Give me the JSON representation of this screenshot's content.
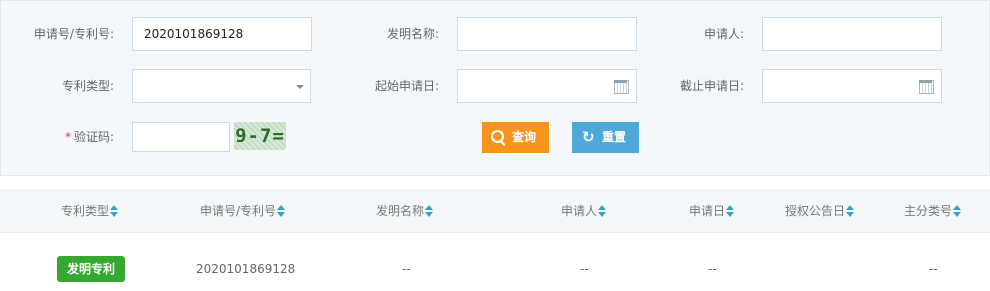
{
  "search": {
    "labels": {
      "app_no": "申请号/专利号:",
      "invention_name": "发明名称:",
      "applicant": "申请人:",
      "patent_type": "专利类型:",
      "start_date": "起始申请日:",
      "end_date": "截止申请日:",
      "captcha": "验证码:",
      "required_mark": "*"
    },
    "values": {
      "app_no": "2020101869128",
      "invention_name": "",
      "applicant": "",
      "patent_type": "",
      "start_date": "",
      "end_date": "",
      "captcha": ""
    },
    "captcha_image_text": "9-7=",
    "buttons": {
      "query": "查询",
      "reset": "重置"
    },
    "colors": {
      "query": "#f7941d",
      "reset": "#4fa8da"
    }
  },
  "table": {
    "columns": [
      "专利类型",
      "申请号/专利号",
      "发明名称",
      "申请人",
      "申请日",
      "授权公告日",
      "主分类号"
    ],
    "rows": [
      {
        "type_badge": "发明专利",
        "app_no": "2020101869128",
        "name": "--",
        "applicant": "--",
        "app_date": "--",
        "grant_date": "",
        "class_no": "--"
      }
    ],
    "badge_color": "#36a832"
  }
}
